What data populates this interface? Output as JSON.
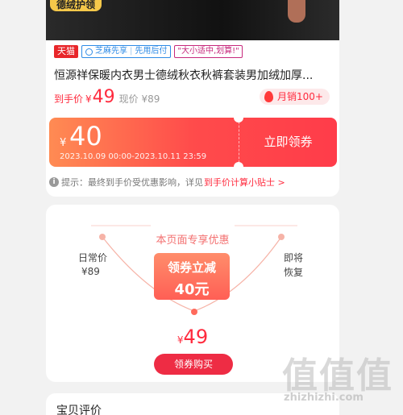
{
  "banner": {
    "tag": "德绒护领"
  },
  "badges": {
    "tmall": "天猫",
    "zhima_a": "芝麻先享",
    "zhima_sep": "|",
    "zhima_b": "先用后付",
    "slogan": "\"大小适中,划算!\""
  },
  "product": {
    "title": "恒源祥保暖内衣男士德绒秋衣秋裤套装男加绒加厚...",
    "price_label": "到手价",
    "currency": "¥",
    "price": "49",
    "old_price": "现价 ¥89",
    "sales": "月销100+"
  },
  "coupon": {
    "currency": "¥",
    "amount": "40",
    "validity": "2023.10.09 00:00-2023.10.11 23:59",
    "button": "立即领券"
  },
  "tip": {
    "icon": "i",
    "text": "提示：最终到手价受优惠影响，详见",
    "link": "到手价计算小贴士 >"
  },
  "promo": {
    "title": "本页面专享优惠",
    "left_label": "日常价",
    "left_value": "¥89",
    "right_label_1": "即将",
    "right_label_2": "恢复",
    "box_line1": "领券立减",
    "box_line2": "40元",
    "currency": "¥",
    "final_price": "49",
    "button": "领券购买"
  },
  "reviews": {
    "title": "宝贝评价"
  },
  "watermark": {
    "big": "值值值",
    "small": "zhizhizhi.com"
  },
  "colors": {
    "accent": "#ff2b3e",
    "coupon_start": "#ff8b53",
    "coupon_end": "#ff3c4a",
    "tmall": "#e8262a",
    "zhima": "#2e8be6",
    "slogan": "#c6297c"
  },
  "icons": {
    "zhima": "zhima-logo-icon",
    "sales": "fire-icon",
    "tip": "info-icon"
  }
}
